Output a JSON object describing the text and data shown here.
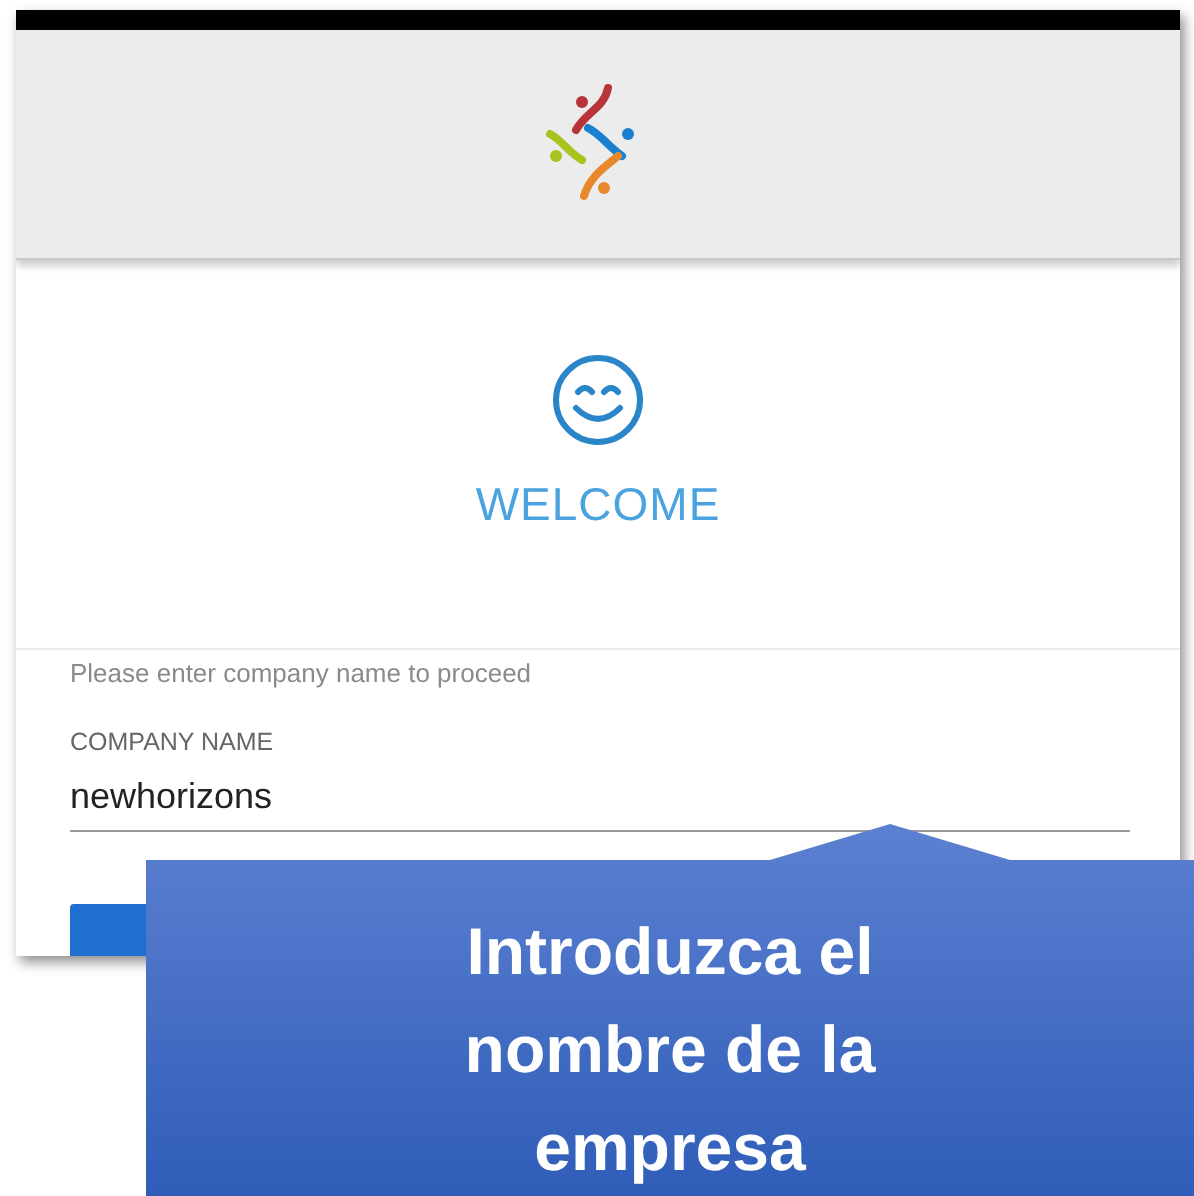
{
  "welcome": {
    "title": "WELCOME"
  },
  "form": {
    "instruction": "Please enter company name to proceed",
    "field": {
      "label": "COMPANY NAME",
      "value": "newhorizons"
    }
  },
  "callout": {
    "text": "Introduzca el nombre de la empresa"
  }
}
